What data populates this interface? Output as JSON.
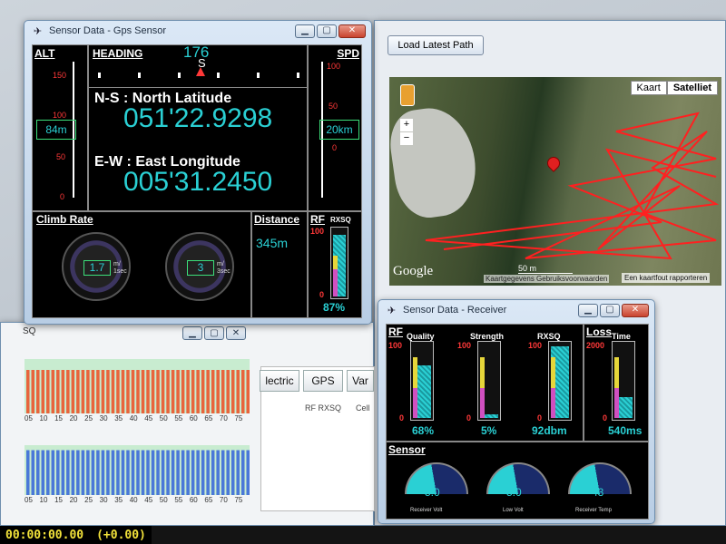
{
  "gps_window": {
    "title": "Sensor Data - Gps Sensor",
    "alt": {
      "label": "ALT",
      "ticks": [
        "150",
        "100",
        "50",
        "0"
      ],
      "value": "84m"
    },
    "heading": {
      "label": "HEADING",
      "value": "176",
      "marker": "S"
    },
    "spd": {
      "label": "SPD",
      "ticks": [
        "100",
        "50",
        "0"
      ],
      "value": "20km"
    },
    "ns": {
      "label": "N-S : North Latitude",
      "value": "051'22.9298"
    },
    "ew": {
      "label": "E-W : East Longitude",
      "value": "005'31.2450"
    },
    "climb": {
      "label": "Climb Rate",
      "g1": "1.7",
      "g2": "3",
      "unit": "m/ 1sec",
      "unit2": "m/ 3sec"
    },
    "distance": {
      "label": "Distance",
      "value": "345m"
    },
    "rf": {
      "label": "RF",
      "sub": "RXSQ",
      "top": "100",
      "bottom": "0",
      "value": "87%"
    }
  },
  "map_window": {
    "load_button": "Load Latest Path",
    "map_type": [
      "Kaart",
      "Satelliet"
    ],
    "zoom": [
      "+",
      "−"
    ],
    "google": "Google",
    "scale": "50 m",
    "footer": "Kaartgegevens  Gebruiksvoorwaarden",
    "report": "Een kaartfout rapporteren"
  },
  "receiver_window": {
    "title": "Sensor Data - Receiver",
    "rf": {
      "label": "RF",
      "quality": "Quality",
      "strength": "Strength",
      "rxsq": "RXSQ",
      "top": "100",
      "bottom": "0",
      "q_val": "68%",
      "s_val": "5%",
      "r_val": "92dbm"
    },
    "loss": {
      "label": "Loss",
      "time": "Time",
      "top": "2000",
      "bottom": "0",
      "value": "540ms"
    },
    "sensor": {
      "label": "Sensor",
      "v1": "5.0",
      "l1": "Receiver Volt",
      "v2": "5.0",
      "l2": "Low Volt",
      "v3": "43",
      "l3": "Receiver Temp"
    }
  },
  "back_window": {
    "title_frag": "SQ",
    "axis": [
      "05",
      "10",
      "15",
      "20",
      "25",
      "30",
      "35",
      "40",
      "45",
      "50",
      "55",
      "60",
      "65",
      "70",
      "75"
    ],
    "tabs": [
      "lectric",
      "GPS",
      "Var"
    ],
    "columns": [
      "RF RXSQ",
      "Cell"
    ]
  },
  "status": {
    "clock": "00:00:00.00",
    "delta": "(+0.00)"
  },
  "chart_data": [
    {
      "type": "bar",
      "title": "",
      "categories": [
        "05",
        "10",
        "15",
        "20",
        "25",
        "30",
        "35",
        "40",
        "45",
        "50",
        "55",
        "60",
        "65",
        "70",
        "75"
      ],
      "series": [
        {
          "values": [
            80,
            80,
            80,
            80,
            80,
            80,
            80,
            80,
            80,
            80,
            80,
            80,
            80,
            80,
            80
          ]
        }
      ],
      "colors": [
        "#e8643c"
      ]
    },
    {
      "type": "bar",
      "title": "",
      "categories": [
        "05",
        "10",
        "15",
        "20",
        "25",
        "30",
        "35",
        "40",
        "45",
        "50",
        "55",
        "60",
        "65",
        "70",
        "75"
      ],
      "series": [
        {
          "values": [
            90,
            90,
            90,
            90,
            90,
            90,
            90,
            90,
            90,
            90,
            90,
            90,
            90,
            90,
            90
          ]
        }
      ],
      "colors": [
        "#4a78d8"
      ]
    }
  ]
}
